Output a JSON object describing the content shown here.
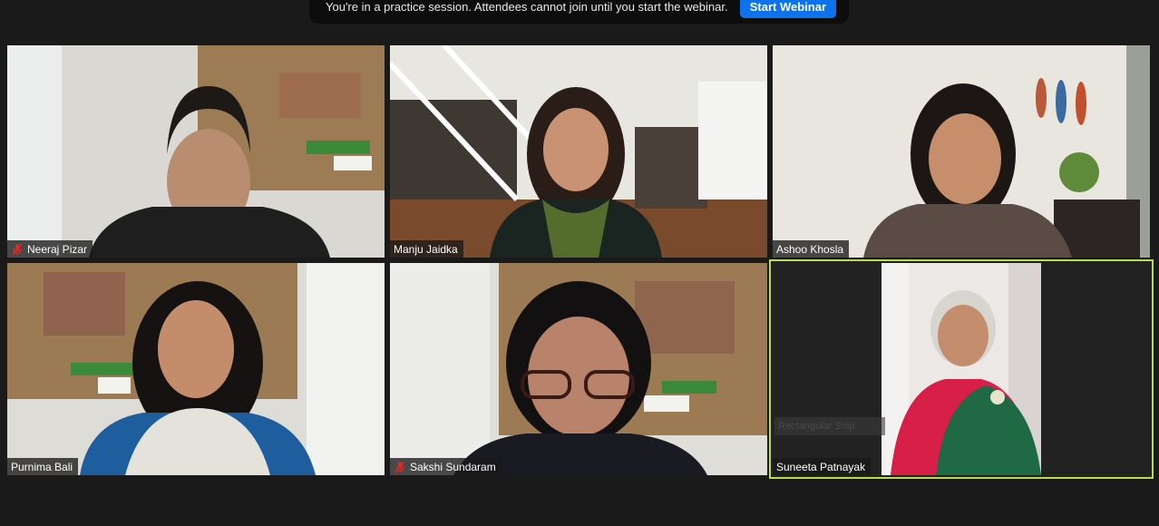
{
  "banner": {
    "message": "You're in a practice session. Attendees cannot join until you start the webinar.",
    "button_label": "Start Webinar"
  },
  "participants": [
    {
      "name": "Neeraj Pizar",
      "muted": true
    },
    {
      "name": "Manju Jaidka",
      "muted": false
    },
    {
      "name": "Ashoo Khosla",
      "muted": false
    },
    {
      "name": "Purnima Bali",
      "muted": false
    },
    {
      "name": "Sakshi Sundaram",
      "muted": true
    },
    {
      "name": "Suneeta Patnayak",
      "muted": false,
      "active_speaker": true
    }
  ],
  "overlay": {
    "snip_label": "Rectangular Snip"
  },
  "colors": {
    "accent": "#0e72ed",
    "active_speaker_border": "#b6dc5a",
    "muted_icon": "#e02828"
  }
}
